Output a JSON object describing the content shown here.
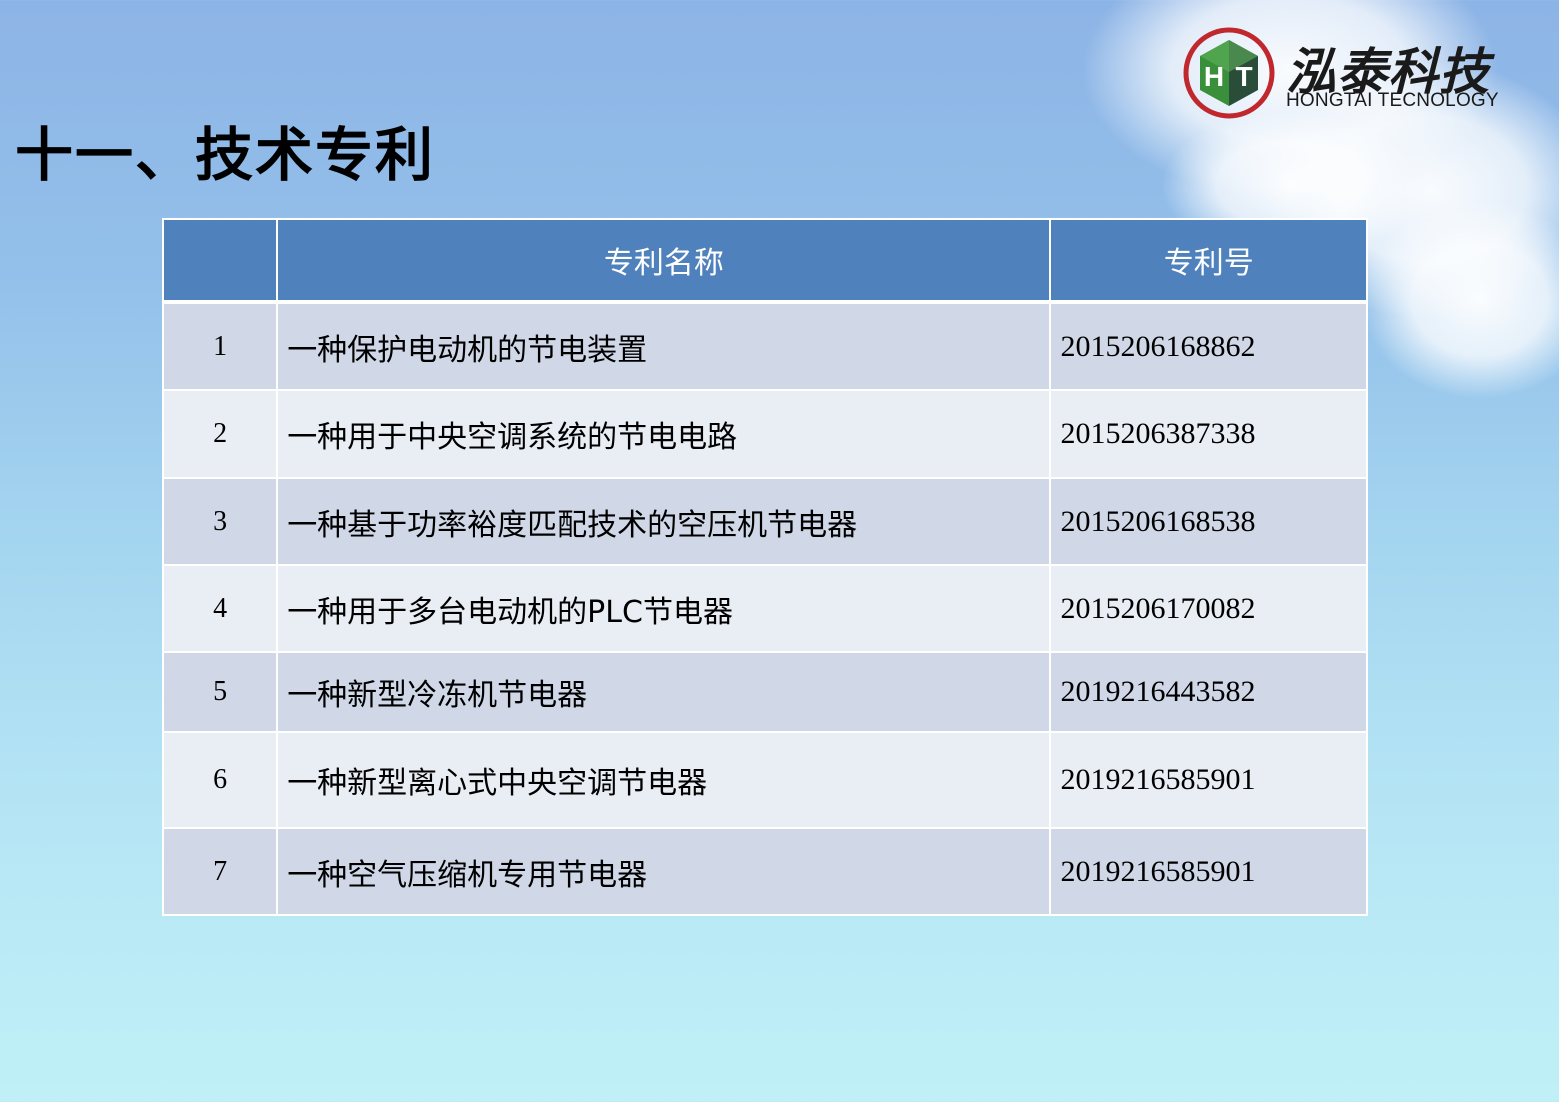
{
  "slide": {
    "title": "十一、技术专利"
  },
  "logo": {
    "mark_letters": [
      "H",
      "T"
    ],
    "name_cn": "泓泰科技",
    "name_en": "HONGTAI TECNOLOGY",
    "colors": {
      "ring": "#c0282d",
      "left_panel": "#3a8f3a",
      "right_panel": "#2a4d3a"
    }
  },
  "table": {
    "headers": [
      "",
      "专利名称",
      "专利号"
    ],
    "rows": [
      {
        "index": "1",
        "name": "一种保护电动机的节电装置",
        "number": "2015206168862"
      },
      {
        "index": "2",
        "name": "一种用于中央空调系统的节电电路",
        "number": "2015206387338"
      },
      {
        "index": "3",
        "name": "一种基于功率裕度匹配技术的空压机节电器",
        "number": "2015206168538"
      },
      {
        "index": "4",
        "name": "一种用于多台电动机的PLC节电器",
        "number": "2015206170082"
      },
      {
        "index": "5",
        "name": "一种新型冷冻机节电器",
        "number": "2019216443582"
      },
      {
        "index": "6",
        "name": "一种新型离心式中央空调节电器",
        "number": "2019216585901"
      },
      {
        "index": "7",
        "name": "一种空气压缩机专用节电器",
        "number": "2019216585901"
      }
    ],
    "colors": {
      "header_bg": "#4f81bd",
      "row_odd_bg": "#d0d8e8",
      "row_even_bg": "#e9edf4"
    }
  }
}
